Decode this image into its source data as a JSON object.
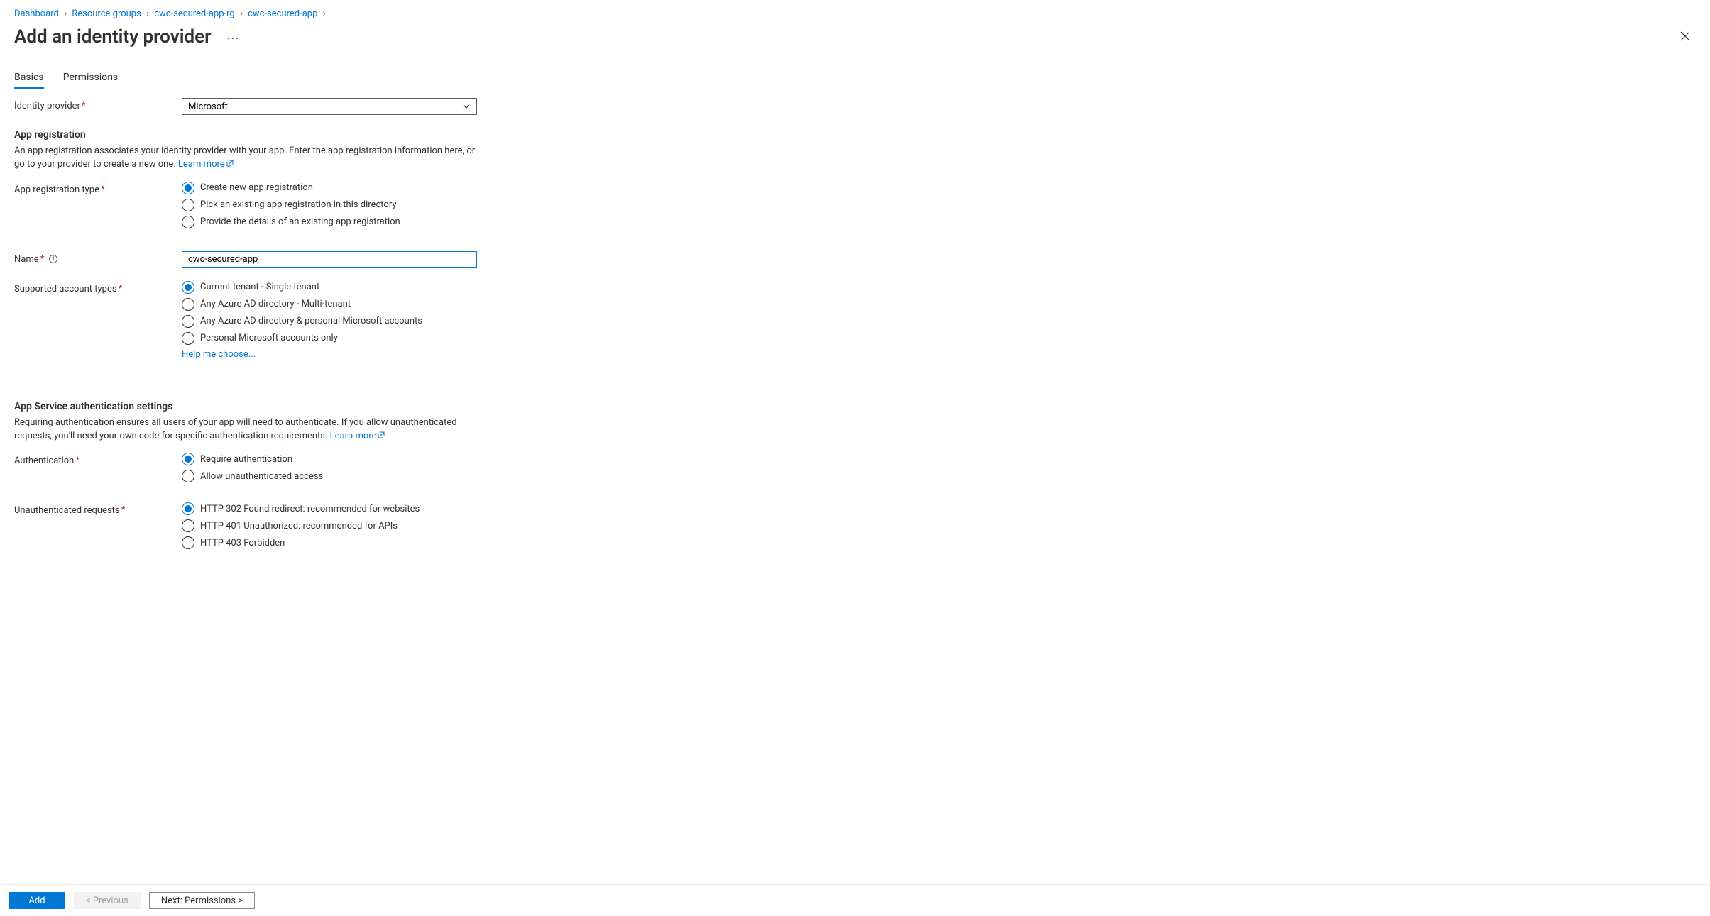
{
  "breadcrumb": {
    "items": [
      {
        "label": "Dashboard"
      },
      {
        "label": "Resource groups"
      },
      {
        "label": "cwc-secured-app-rg"
      },
      {
        "label": "cwc-secured-app"
      }
    ]
  },
  "page_title": "Add an identity provider",
  "tabs": [
    {
      "label": "Basics",
      "active": true
    },
    {
      "label": "Permissions",
      "active": false
    }
  ],
  "identity_provider": {
    "label": "Identity provider",
    "value": "Microsoft"
  },
  "app_registration": {
    "heading": "App registration",
    "description": "An app registration associates your identity provider with your app. Enter the app registration information here, or go to your provider to create a new one.",
    "learn_more": "Learn more"
  },
  "app_reg_type": {
    "label": "App registration type",
    "options": [
      {
        "label": "Create new app registration",
        "checked": true
      },
      {
        "label": "Pick an existing app registration in this directory",
        "checked": false
      },
      {
        "label": "Provide the details of an existing app registration",
        "checked": false
      }
    ]
  },
  "name_field": {
    "label": "Name",
    "value": "cwc-secured-app"
  },
  "account_types": {
    "label": "Supported account types",
    "options": [
      {
        "label": "Current tenant - Single tenant",
        "checked": true
      },
      {
        "label": "Any Azure AD directory - Multi-tenant",
        "checked": false
      },
      {
        "label": "Any Azure AD directory & personal Microsoft accounts",
        "checked": false
      },
      {
        "label": "Personal Microsoft accounts only",
        "checked": false
      }
    ],
    "help_link": "Help me choose..."
  },
  "auth_settings": {
    "heading": "App Service authentication settings",
    "description": "Requiring authentication ensures all users of your app will need to authenticate. If you allow unauthenticated requests, you'll need your own code for specific authentication requirements.",
    "learn_more": "Learn more"
  },
  "authentication": {
    "label": "Authentication",
    "options": [
      {
        "label": "Require authentication",
        "checked": true
      },
      {
        "label": "Allow unauthenticated access",
        "checked": false
      }
    ]
  },
  "unauth_requests": {
    "label": "Unauthenticated requests",
    "options": [
      {
        "label": "HTTP 302 Found redirect: recommended for websites",
        "checked": true
      },
      {
        "label": "HTTP 401 Unauthorized: recommended for APIs",
        "checked": false
      },
      {
        "label": "HTTP 403 Forbidden",
        "checked": false
      }
    ]
  },
  "footer": {
    "add": "Add",
    "previous": "< Previous",
    "next": "Next: Permissions >"
  }
}
